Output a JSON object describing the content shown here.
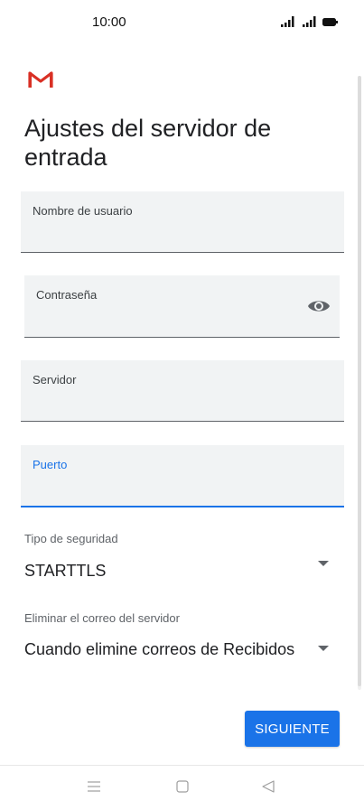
{
  "status_bar": {
    "time": "10:00",
    "icons": [
      "signal-icon",
      "signal-icon",
      "battery-icon"
    ]
  },
  "header": {
    "logo": "gmail-logo",
    "title": "Ajustes del servidor de entrada"
  },
  "form": {
    "username_label": "Nombre de usuario",
    "username_value": "",
    "password_label": "Contraseña",
    "password_value": "",
    "password_toggle_icon": "eye-icon",
    "server_label": "Servidor",
    "server_value": "",
    "port_label": "Puerto",
    "port_value": "",
    "security_label": "Tipo de seguridad",
    "security_value": "STARTTLS",
    "delete_label": "Eliminar el correo del servidor",
    "delete_value": "Cuando elimine correos de Recibidos"
  },
  "actions": {
    "next_label": "SIGUIENTE"
  },
  "nav_bar": {
    "icons": [
      "menu-icon",
      "home-icon",
      "back-icon"
    ]
  },
  "colors": {
    "accent": "#1a73e8",
    "field_bg": "#f1f3f4",
    "gmail_red": "#d93025"
  }
}
